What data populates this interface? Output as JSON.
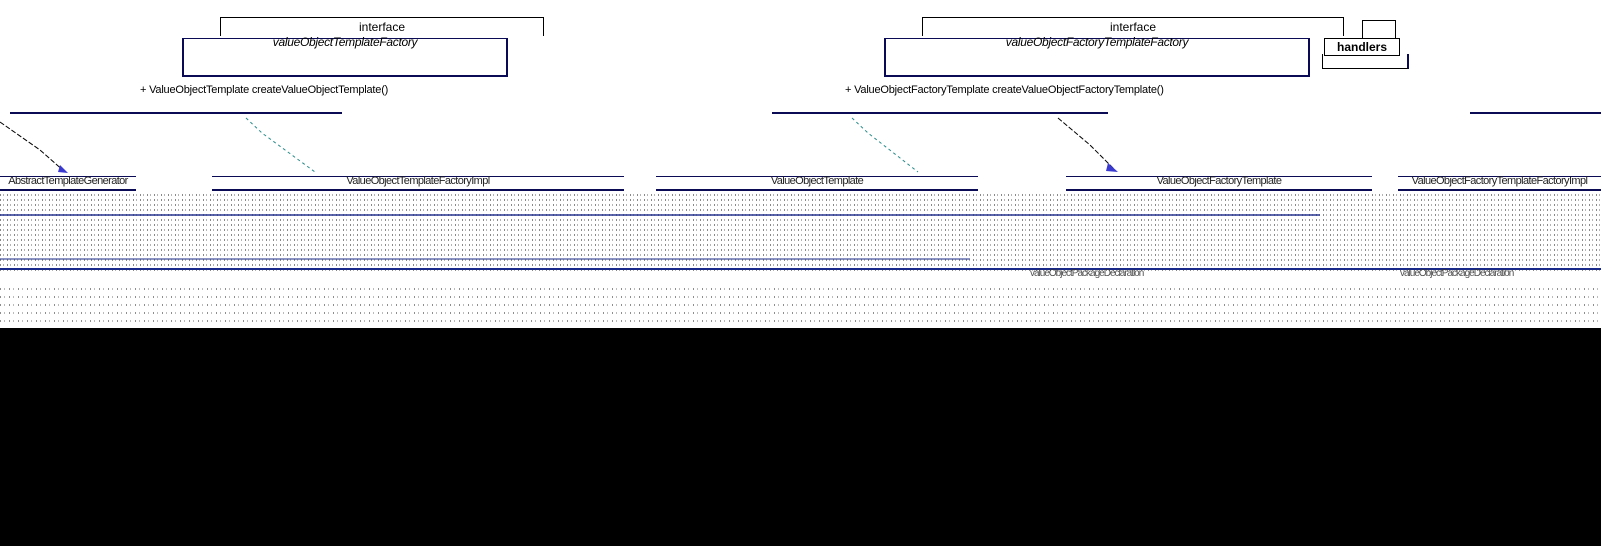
{
  "interfaces": [
    {
      "stereotype": "interface",
      "name": "valueObjectTemplateFactory",
      "operation": "+ ValueObjectTemplate createValueObjectTemplate()"
    },
    {
      "stereotype": "interface",
      "name": "valueObjectFactoryTemplateFactory",
      "operation": "+ ValueObjectFactoryTemplate createValueObjectFactoryTemplate()"
    }
  ],
  "package": {
    "label": "handlers"
  },
  "classes": [
    {
      "label": "AbstractTemplateGenerator"
    },
    {
      "label": "ValueObjectTemplateFactoryImpl"
    },
    {
      "label": "ValueObjectTemplate"
    },
    {
      "label": "ValueObjectFactoryTemplate"
    },
    {
      "label": "ValueObjectFactoryTemplateFactoryImpl"
    }
  ],
  "notes": [
    {
      "label": "valueObjectPackageDeclaration"
    },
    {
      "label": "valueObjectPackageDeclaration"
    }
  ],
  "colors": {
    "border": "#0b0b55",
    "teal_arrow": "#2a8a8a",
    "blue_arrow": "#3a3ad0",
    "background": "#ffffff",
    "letterbox": "#000000"
  }
}
